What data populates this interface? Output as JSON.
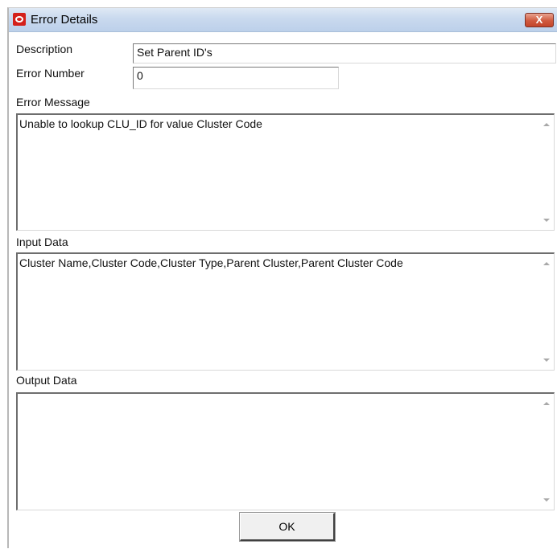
{
  "window": {
    "title": "Error Details",
    "close_glyph": "X",
    "app_icon": "oracle-logo-icon"
  },
  "fields": {
    "description_label": "Description",
    "description_value": "Set Parent ID's",
    "error_number_label": "Error Number",
    "error_number_value": "0",
    "error_message_label": "Error Message",
    "error_message_value": "Unable to lookup CLU_ID for value Cluster Code",
    "input_data_label": "Input Data",
    "input_data_value": "Cluster Name,Cluster Code,Cluster Type,Parent Cluster,Parent Cluster Code",
    "output_data_label": "Output Data",
    "output_data_value": ""
  },
  "buttons": {
    "ok_label": "OK"
  },
  "colors": {
    "title_bar": "#c9d9ee",
    "close_button": "#d05a3f",
    "oracle_red": "#d4201a"
  }
}
